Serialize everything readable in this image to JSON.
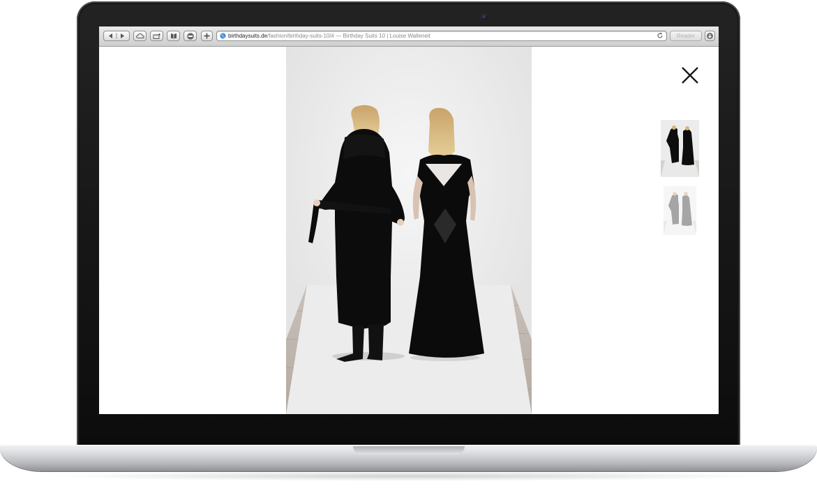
{
  "browser": {
    "url_domain": "birthdaysuits.de",
    "url_path": "/fashion/birthday-suits-10/#",
    "page_title": " — Birthday Suits 10 | Louise Walleneit",
    "reader_label": "Reader",
    "toolbar_icons": [
      "back-icon",
      "forward-icon",
      "icloud-icon",
      "share-icon",
      "reading-list-icon",
      "adblock-icon",
      "add-tab-icon",
      "globe-icon",
      "reload-icon",
      "download-icon"
    ]
  },
  "lightbox": {
    "close_icon": "close-icon",
    "thumbnails": [
      {
        "state": "active"
      },
      {
        "state": "inactive"
      }
    ]
  },
  "colors": {
    "laptop_bezel": "#111111",
    "page_background": "#ffffff",
    "photo_backdrop": "#efefef",
    "garments": "#0b0b0b"
  }
}
